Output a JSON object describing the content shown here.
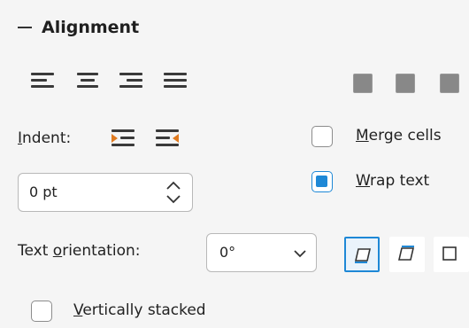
{
  "section": {
    "title": "Alignment",
    "collapse_icon": "minus-icon"
  },
  "horizontal_alignment": {
    "icons": [
      "align-left-icon",
      "align-center-icon",
      "align-right-icon",
      "align-justify-icon"
    ]
  },
  "vertical_alignment": {
    "icons": [
      "align-top-icon",
      "align-middle-icon",
      "align-bottom-icon"
    ]
  },
  "indent": {
    "label_prefix": "",
    "label_mnemonic": "I",
    "label_rest": "ndent:",
    "increase_icon": "increase-indent-icon",
    "decrease_icon": "decrease-indent-icon",
    "value": "0 pt"
  },
  "merge_cells": {
    "label_mnemonic": "M",
    "label_rest": "erge cells",
    "checked": false
  },
  "wrap_text": {
    "label_mnemonic": "W",
    "label_rest": "rap text",
    "checked": true
  },
  "text_orientation": {
    "label_prefix": "Text ",
    "label_mnemonic": "o",
    "label_rest": "rientation:",
    "value": "0°",
    "options_icons": [
      "orientation-bottom-icon",
      "orientation-top-icon",
      "orientation-cell-icon"
    ]
  },
  "vertically_stacked": {
    "label_mnemonic": "V",
    "label_rest": "ertically stacked",
    "checked": false
  },
  "colors": {
    "accent": "#1e88d6",
    "background": "#f5f5f5"
  }
}
